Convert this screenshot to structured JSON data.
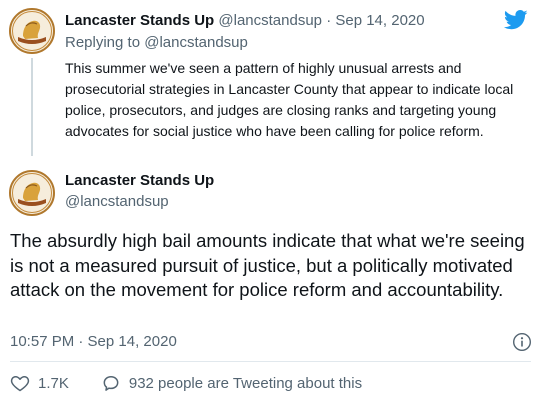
{
  "reply_tweet": {
    "display_name": "Lancaster Stands Up",
    "handle": "@lancstandsup",
    "separator": "·",
    "date": "Sep 14, 2020",
    "replying_to_prefix": "Replying to",
    "replying_to_handle": "@lancstandsup",
    "text": "This summer we've seen a pattern of highly unusual arrests and prosecutorial strategies in Lancaster County that appear to indicate local police, prosecutors, and judges are closing ranks and targeting young advocates for social justice who have been calling for police reform."
  },
  "main_tweet": {
    "display_name": "Lancaster Stands Up",
    "handle": "@lancstandsup",
    "text": "The absurdly high bail amounts indicate that what we're seeing is not a measured pursuit of justice, but a politically motivated attack on the movement for police reform and accountability.",
    "timestamp": "10:57 PM · Sep 14, 2020"
  },
  "actions": {
    "like_count": "1.7K",
    "tweeting_label": "932 people are Tweeting about this"
  },
  "icons": {
    "brand": "twitter-bird-icon",
    "info": "info-icon",
    "like": "heart-icon",
    "reply": "speech-bubble-icon"
  },
  "colors": {
    "twitter_blue": "#1d9bf0",
    "text": "#0f1419",
    "muted": "#536471",
    "avatar_border": "#b0782d"
  }
}
